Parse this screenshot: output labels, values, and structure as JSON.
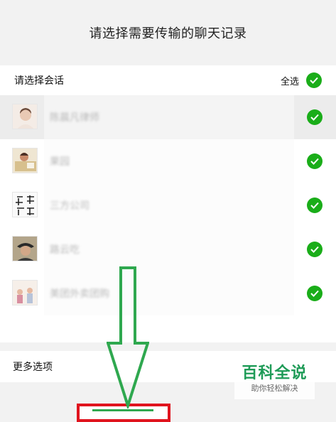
{
  "header": {
    "title": "请选择需要传输的聊天记录"
  },
  "conversations": {
    "section_title": "请选择会话",
    "select_all_label": "全选",
    "items": [
      {
        "name": "陈晨凡律师"
      },
      {
        "name": "果园"
      },
      {
        "name": "三方公司"
      },
      {
        "name": "路云吃"
      },
      {
        "name": "美团外卖团购"
      }
    ]
  },
  "more": {
    "label": "更多选项"
  },
  "watermark": {
    "title": "百科全说",
    "subtitle": "助你轻松解决"
  },
  "colors": {
    "check_green": "#1aad19",
    "annotation_green": "#2fa84f",
    "annotation_red": "#e0141e"
  }
}
